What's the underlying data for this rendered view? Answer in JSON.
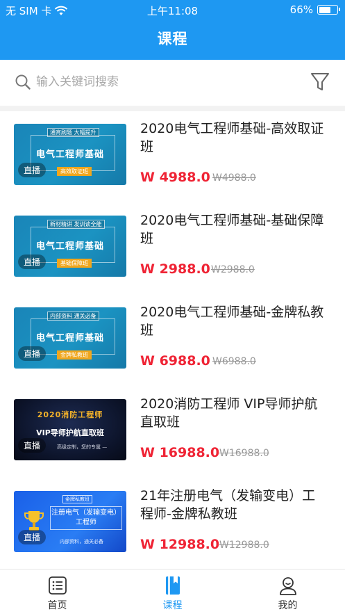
{
  "status_bar": {
    "carrier": "无 SIM 卡",
    "time": "上午11:08",
    "battery": "66%",
    "battery_level": 0.66
  },
  "header": {
    "title": "课程"
  },
  "search": {
    "placeholder": "输入关键词搜索",
    "value": ""
  },
  "courses": [
    {
      "title": "2020电气工程师基础-高效取证班",
      "price": "W 4988.0",
      "original_price": "W4988.0",
      "thumbnail": {
        "style": "blue",
        "tag": "通宵刷题 大幅提升",
        "main": "电气工程师基础",
        "sub": "高效取证班",
        "badge": "直播"
      }
    },
    {
      "title": "2020电气工程师基础-基础保障班",
      "price": "W 2988.0",
      "original_price": "W2988.0",
      "thumbnail": {
        "style": "blue",
        "tag": "新材精讲 发训读全能",
        "main": "电气工程师基础",
        "sub": "基础保障班",
        "badge": "直播"
      }
    },
    {
      "title": "2020电气工程师基础-金牌私教班",
      "price": "W 6988.0",
      "original_price": "W6988.0",
      "thumbnail": {
        "style": "blue",
        "tag": "内部资料 通关必备",
        "main": "电气工程师基础",
        "sub": "金牌私教班",
        "badge": "直播"
      }
    },
    {
      "title": "2020消防工程师 VIP导师护航直取班",
      "price": "W 16988.0",
      "original_price": "W16988.0",
      "thumbnail": {
        "style": "dark",
        "tag": "2020消防工程师",
        "main": "VIP导师护航直取班",
        "sub": "高级定制，您的专属 —",
        "badge": "直播"
      }
    },
    {
      "title": "21年注册电气（发输变电）工程师-金牌私教班",
      "price": "W 12988.0",
      "original_price": "W12988.0",
      "thumbnail": {
        "style": "bright",
        "tag": "金牌私教班",
        "main": "注册电气（发输变电）工程师",
        "sub": "内部资料，通关必备",
        "badge": "直播"
      }
    }
  ],
  "tabbar": [
    {
      "label": "首页",
      "icon": "home-list-icon",
      "active": false
    },
    {
      "label": "课程",
      "icon": "book-icon",
      "active": true
    },
    {
      "label": "我的",
      "icon": "user-icon",
      "active": false
    }
  ],
  "colors": {
    "brand": "#1e98f2",
    "price": "#ef2435"
  }
}
